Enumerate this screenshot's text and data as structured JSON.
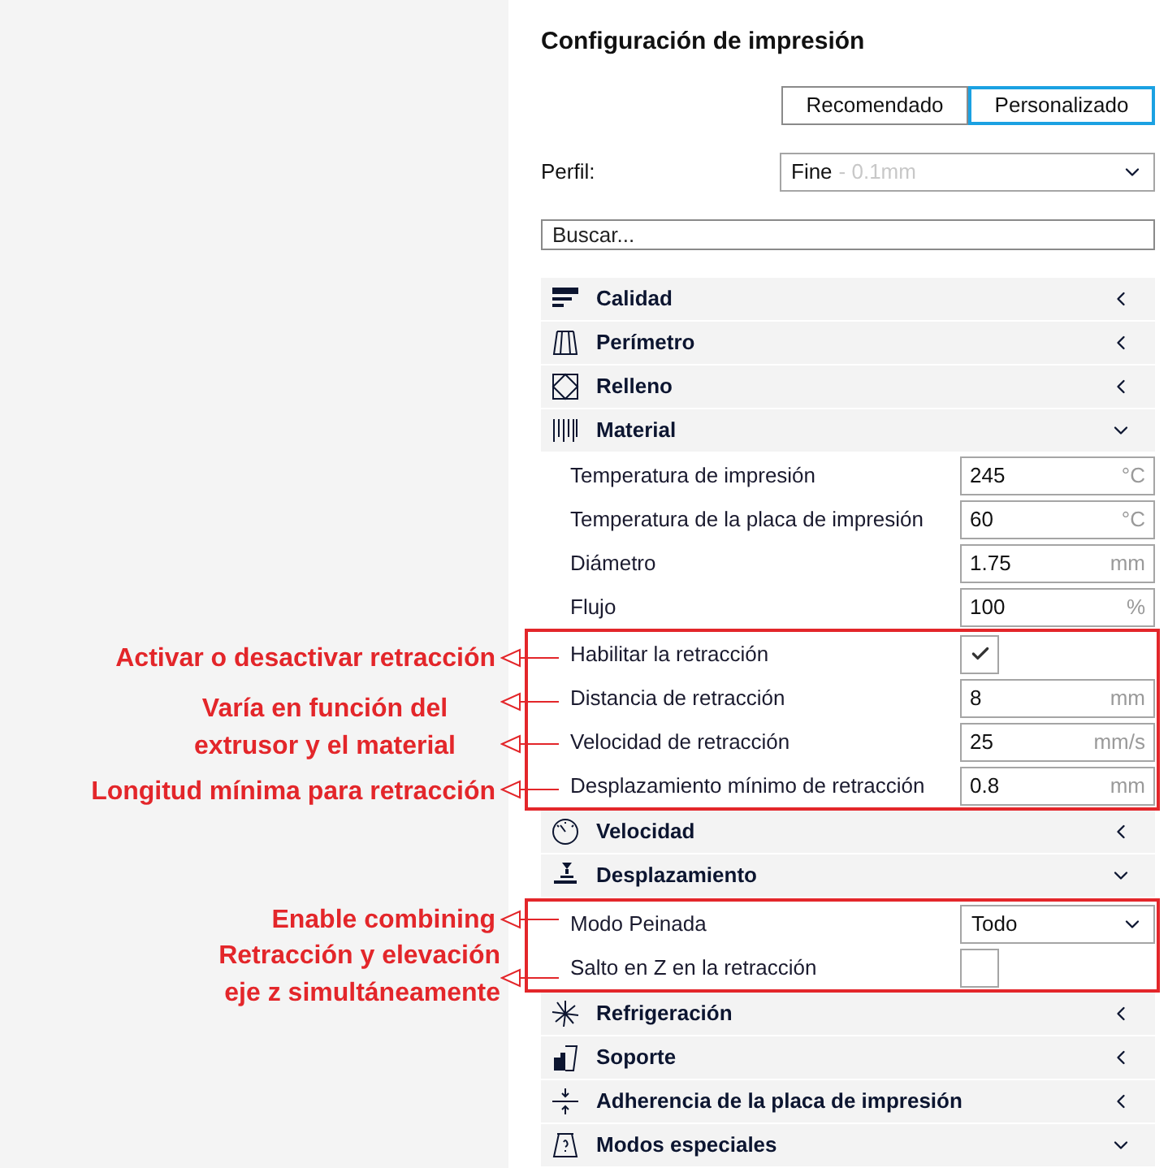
{
  "panel": {
    "title": "Configuración de impresión",
    "modes": [
      {
        "label": "Recomendado",
        "selected": false
      },
      {
        "label": "Personalizado",
        "selected": true
      }
    ],
    "profile": {
      "label": "Perfil:",
      "value": "Fine",
      "detail": "- 0.1mm"
    },
    "search": {
      "placeholder": "Buscar..."
    },
    "sections": [
      {
        "title": "Calidad",
        "expanded": false
      },
      {
        "title": "Perímetro",
        "expanded": false
      },
      {
        "title": "Relleno",
        "expanded": false
      },
      {
        "title": "Material",
        "expanded": true,
        "groups": [
          {
            "highlighted": false,
            "settings": [
              {
                "kind": "number",
                "label": "Temperatura de impresión",
                "value": "245",
                "unit": "°C"
              },
              {
                "kind": "number",
                "label": "Temperatura de la placa de impresión",
                "value": "60",
                "unit": "°C"
              },
              {
                "kind": "number",
                "label": "Diámetro",
                "value": "1.75",
                "unit": "mm"
              },
              {
                "kind": "number",
                "label": "Flujo",
                "value": "100",
                "unit": "%"
              }
            ]
          },
          {
            "highlighted": true,
            "settings": [
              {
                "kind": "checkbox",
                "label": "Habilitar la retracción",
                "checked": true
              },
              {
                "kind": "number",
                "label": "Distancia de retracción",
                "value": "8",
                "unit": "mm"
              },
              {
                "kind": "number",
                "label": "Velocidad de retracción",
                "value": "25",
                "unit": "mm/s"
              },
              {
                "kind": "number",
                "label": "Desplazamiento mínimo de retracción",
                "value": "0.8",
                "unit": "mm"
              }
            ]
          }
        ]
      },
      {
        "title": "Velocidad",
        "expanded": false
      },
      {
        "title": "Desplazamiento",
        "expanded": true,
        "groups": [
          {
            "highlighted": true,
            "settings": [
              {
                "kind": "select",
                "label": "Modo Peinada",
                "value": "Todo"
              },
              {
                "kind": "checkbox",
                "label": "Salto en Z en la retracción",
                "checked": false
              }
            ]
          }
        ]
      },
      {
        "title": "Refrigeración",
        "expanded": false
      },
      {
        "title": "Soporte",
        "expanded": false
      },
      {
        "title": "Adherencia de la placa de impresión",
        "expanded": false
      },
      {
        "title": "Modos especiales",
        "expanded": true
      }
    ]
  },
  "callouts": [
    {
      "text": "Activar o desactivar retracción"
    },
    {
      "text": "Varía en función del\nextrusor y el material"
    },
    {
      "text": "Longitud mínima para retracción"
    },
    {
      "text": "Enable combining"
    },
    {
      "text": "Retracción y elevación\neje z simultáneamente"
    }
  ]
}
